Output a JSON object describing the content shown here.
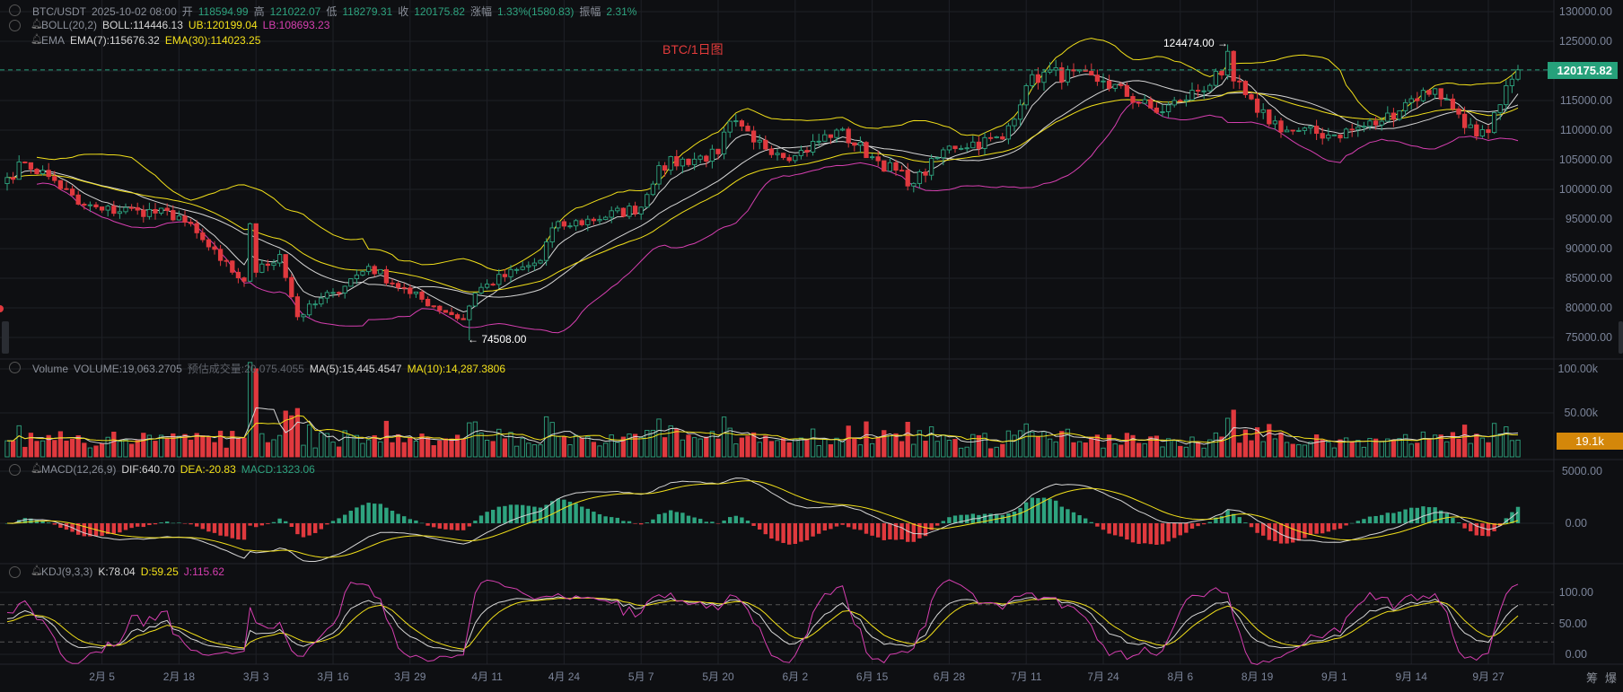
{
  "header": {
    "symbol": "BTC/USDT",
    "datetime": "2025-10-02 08:00",
    "open_label": "开",
    "open": "118594.99",
    "high_label": "高",
    "high": "121022.07",
    "low_label": "低",
    "low": "118279.31",
    "close_label": "收",
    "close": "120175.82",
    "change_label": "涨幅",
    "change": "1.33%(1580.83)",
    "amplitude_label": "振幅",
    "amplitude": "2.31%"
  },
  "boll": {
    "name": "BOLL(20,2)",
    "boll": "BOLL:114446.13",
    "ub": "UB:120199.04",
    "lb": "LB:108693.23"
  },
  "ema": {
    "name": "EMA",
    "ema7": "EMA(7):115676.32",
    "ema30": "EMA(30):114023.25"
  },
  "volume": {
    "name": "Volume",
    "volume": "VOLUME:19,063.2705",
    "estimate": "预估成交量:20,075.4055",
    "ma5": "MA(5):15,445.4547",
    "ma10": "MA(10):14,287.3806",
    "axis": [
      "100.00k",
      "50.00k"
    ],
    "current_tag": "19.1k"
  },
  "macd": {
    "name": "MACD(12,26,9)",
    "dif": "DIF:640.70",
    "dea": "DEA:-20.83",
    "macd": "MACD:1323.06",
    "axis": [
      "5000.00",
      "0.00"
    ]
  },
  "kdj": {
    "name": "KDJ(9,3,3)",
    "k": "K:78.04",
    "d": "D:59.25",
    "j": "J:115.62",
    "axis": [
      "100.00",
      "50.00",
      "0.00"
    ]
  },
  "chart_title": "BTC/1日图",
  "price_axis": [
    "130000.00",
    "125000.00",
    "120000.00",
    "115000.00",
    "110000.00",
    "105000.00",
    "100000.00",
    "95000.00",
    "90000.00",
    "85000.00",
    "80000.00",
    "75000.00"
  ],
  "current_price_tag": "120175.82",
  "max_annotation": "124474.00 →",
  "min_annotation": "← 74508.00",
  "time_axis": [
    "2月 5",
    "2月 18",
    "3月 3",
    "3月 16",
    "3月 29",
    "4月 11",
    "4月 24",
    "5月 7",
    "5月 20",
    "6月 2",
    "6月 15",
    "6月 28",
    "7月 11",
    "7月 24",
    "8月 6",
    "8月 19",
    "9月 1",
    "9月 14",
    "9月 27"
  ],
  "corner_buttons": [
    "筹",
    "爆"
  ],
  "colors": {
    "up": "#2ea37f",
    "down": "#e0393e",
    "boll_mid": "#d6d6d6",
    "ub": "#f2e01a",
    "lb": "#d63fb0",
    "volume_tag": "#d4870a",
    "price_tag": "#26a17b"
  },
  "chart_data": {
    "type": "candlestick",
    "interval": "1D",
    "days": 256,
    "first_day_label_index": 16,
    "label_step_days": 13,
    "close_keypoints": [
      [
        0,
        102000
      ],
      [
        3,
        104500
      ],
      [
        8,
        101500
      ],
      [
        12,
        97500
      ],
      [
        16,
        96500
      ],
      [
        22,
        96500
      ],
      [
        29,
        95500
      ],
      [
        36,
        88000
      ],
      [
        40,
        84500
      ],
      [
        41,
        94200
      ],
      [
        42,
        86000
      ],
      [
        46,
        89000
      ],
      [
        49,
        78500
      ],
      [
        55,
        82600
      ],
      [
        61,
        87000
      ],
      [
        68,
        82400
      ],
      [
        77,
        78000
      ],
      [
        79,
        82500
      ],
      [
        81,
        84000
      ],
      [
        90,
        88000
      ],
      [
        92,
        93500
      ],
      [
        94,
        93800
      ],
      [
        107,
        97000
      ],
      [
        110,
        104000
      ],
      [
        120,
        106000
      ],
      [
        122,
        111500
      ],
      [
        126,
        108000
      ],
      [
        133,
        105700
      ],
      [
        140,
        110000
      ],
      [
        146,
        105500
      ],
      [
        153,
        101000
      ],
      [
        159,
        107300
      ],
      [
        168,
        108500
      ],
      [
        172,
        117500
      ],
      [
        175,
        119800
      ],
      [
        185,
        118300
      ],
      [
        194,
        113000
      ],
      [
        198,
        114900
      ],
      [
        205,
        119300
      ],
      [
        206,
        123300
      ],
      [
        207,
        118300
      ],
      [
        211,
        113000
      ],
      [
        216,
        110000
      ],
      [
        224,
        109200
      ],
      [
        232,
        111500
      ],
      [
        237,
        115300
      ],
      [
        241,
        117000
      ],
      [
        245,
        112700
      ],
      [
        248,
        109000
      ],
      [
        250,
        109600
      ],
      [
        252,
        114300
      ],
      [
        254,
        118600
      ],
      [
        255,
        120175.82
      ]
    ],
    "extremes": {
      "max": {
        "day": 206,
        "value": 124474.0
      },
      "min": {
        "day": 78,
        "value": 74508.0
      }
    },
    "last_candle": {
      "open": 118594.99,
      "high": 121022.07,
      "low": 118279.31,
      "close": 120175.82,
      "volume": 19063.27
    },
    "price_ylim": [
      72000,
      132000
    ],
    "volume_ylim": [
      0,
      100000
    ],
    "macd_unit": 5000,
    "kdj_levels": [
      20,
      50,
      80
    ]
  }
}
